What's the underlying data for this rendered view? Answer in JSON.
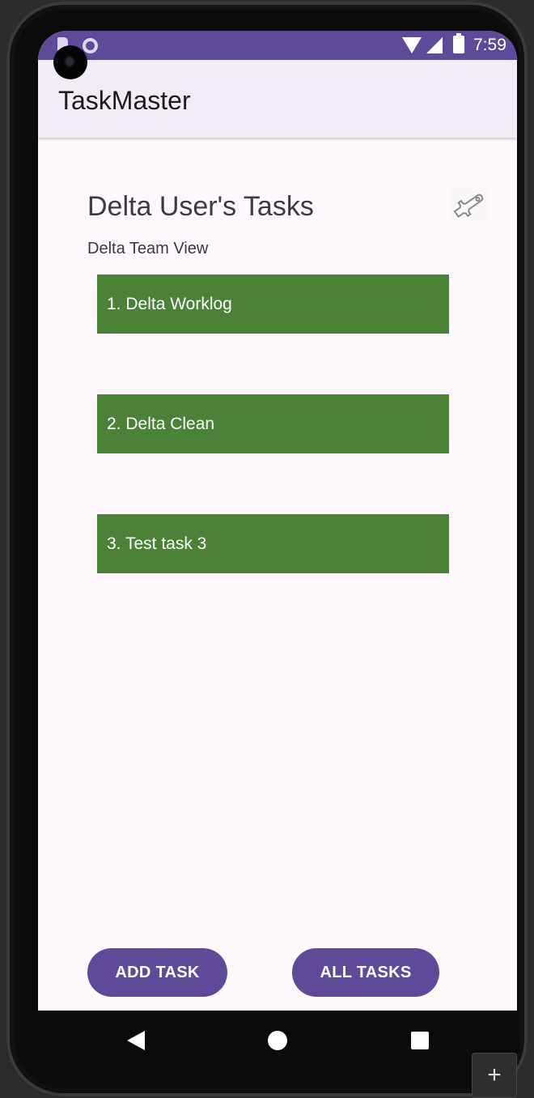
{
  "status_bar": {
    "time": "7:59"
  },
  "app_bar": {
    "title": "TaskMaster"
  },
  "main": {
    "title": "Delta User's Tasks",
    "subtitle": "Delta Team View",
    "tasks": [
      {
        "label": "1. Delta Worklog"
      },
      {
        "label": "2. Delta Clean"
      },
      {
        "label": "3. Test task 3"
      }
    ]
  },
  "buttons": {
    "add_task": "ADD TASK",
    "all_tasks": "ALL TASKS"
  },
  "fab": {
    "symbol": "+"
  },
  "colors": {
    "primary": "#5e4a98",
    "task_background": "#4a8237",
    "app_bar_background": "#f1ecf6",
    "screen_background": "#fef7fc"
  },
  "icons": [
    "sd-card-icon",
    "notification-dot-icon",
    "wifi-icon",
    "signal-icon",
    "battery-icon",
    "wrench-icon",
    "back-icon",
    "home-icon",
    "recents-icon",
    "plus-icon"
  ]
}
